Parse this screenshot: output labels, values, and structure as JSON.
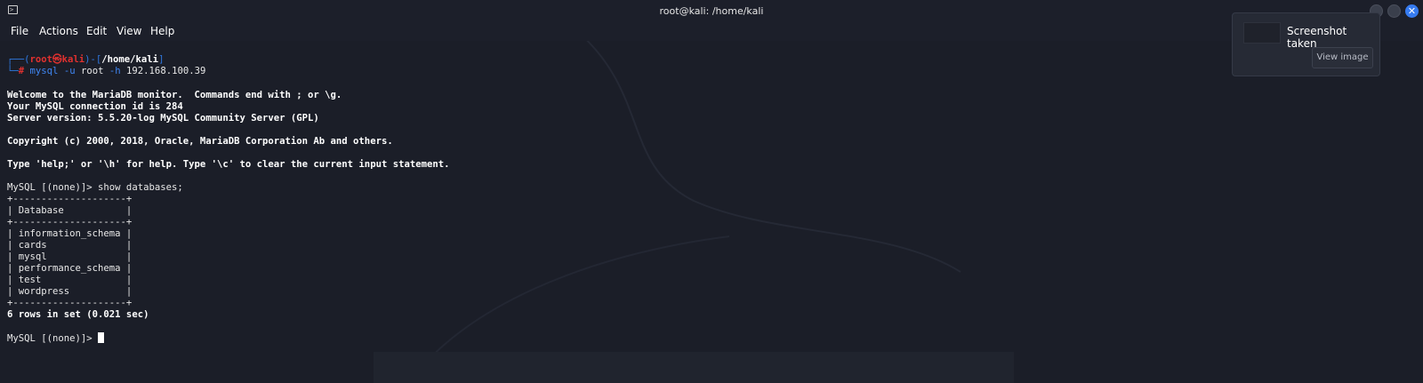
{
  "window": {
    "title": "root@kali: /home/kali",
    "close_glyph": "✕"
  },
  "menu": {
    "items": [
      "File",
      "Actions",
      "Edit",
      "View",
      "Help"
    ]
  },
  "prompt": {
    "open": "┌──(",
    "user": "root",
    "at": "㉿",
    "host": "kali",
    "sep": ")-[",
    "path": "/home/kali",
    "close": "]",
    "prefix2": "└─",
    "hash": "#",
    "cmd_name": "mysql",
    "cmd_flag1": "-u",
    "cmd_arg1": "root",
    "cmd_flag2": "-h",
    "cmd_arg2": "192.168.100.39"
  },
  "output": {
    "welcome": "Welcome to the MariaDB monitor.  Commands end with ; or \\g.",
    "conn_id": "Your MySQL connection id is 284",
    "server_version": "Server version: 5.5.20-log MySQL Community Server (GPL)",
    "copyright": "Copyright (c) 2000, 2018, Oracle, MariaDB Corporation Ab and others.",
    "help": "Type 'help;' or '\\h' for help. Type '\\c' to clear the current input statement.",
    "query": "MySQL [(none)]> show databases;",
    "table_border": "+--------------------+",
    "table_header": "| Database           |",
    "rows": [
      "| information_schema |",
      "| cards              |",
      "| mysql              |",
      "| performance_schema |",
      "| test               |",
      "| wordpress          |"
    ],
    "summary": "6 rows in set (0.021 sec)",
    "final_prompt": "MySQL [(none)]> "
  },
  "notification": {
    "title": "Screenshot taken",
    "button": "View image"
  },
  "colors": {
    "background": "#1b1e28",
    "prompt_blue": "#2f79e0",
    "prompt_red": "#e0312f",
    "accent_close": "#367bf0"
  }
}
